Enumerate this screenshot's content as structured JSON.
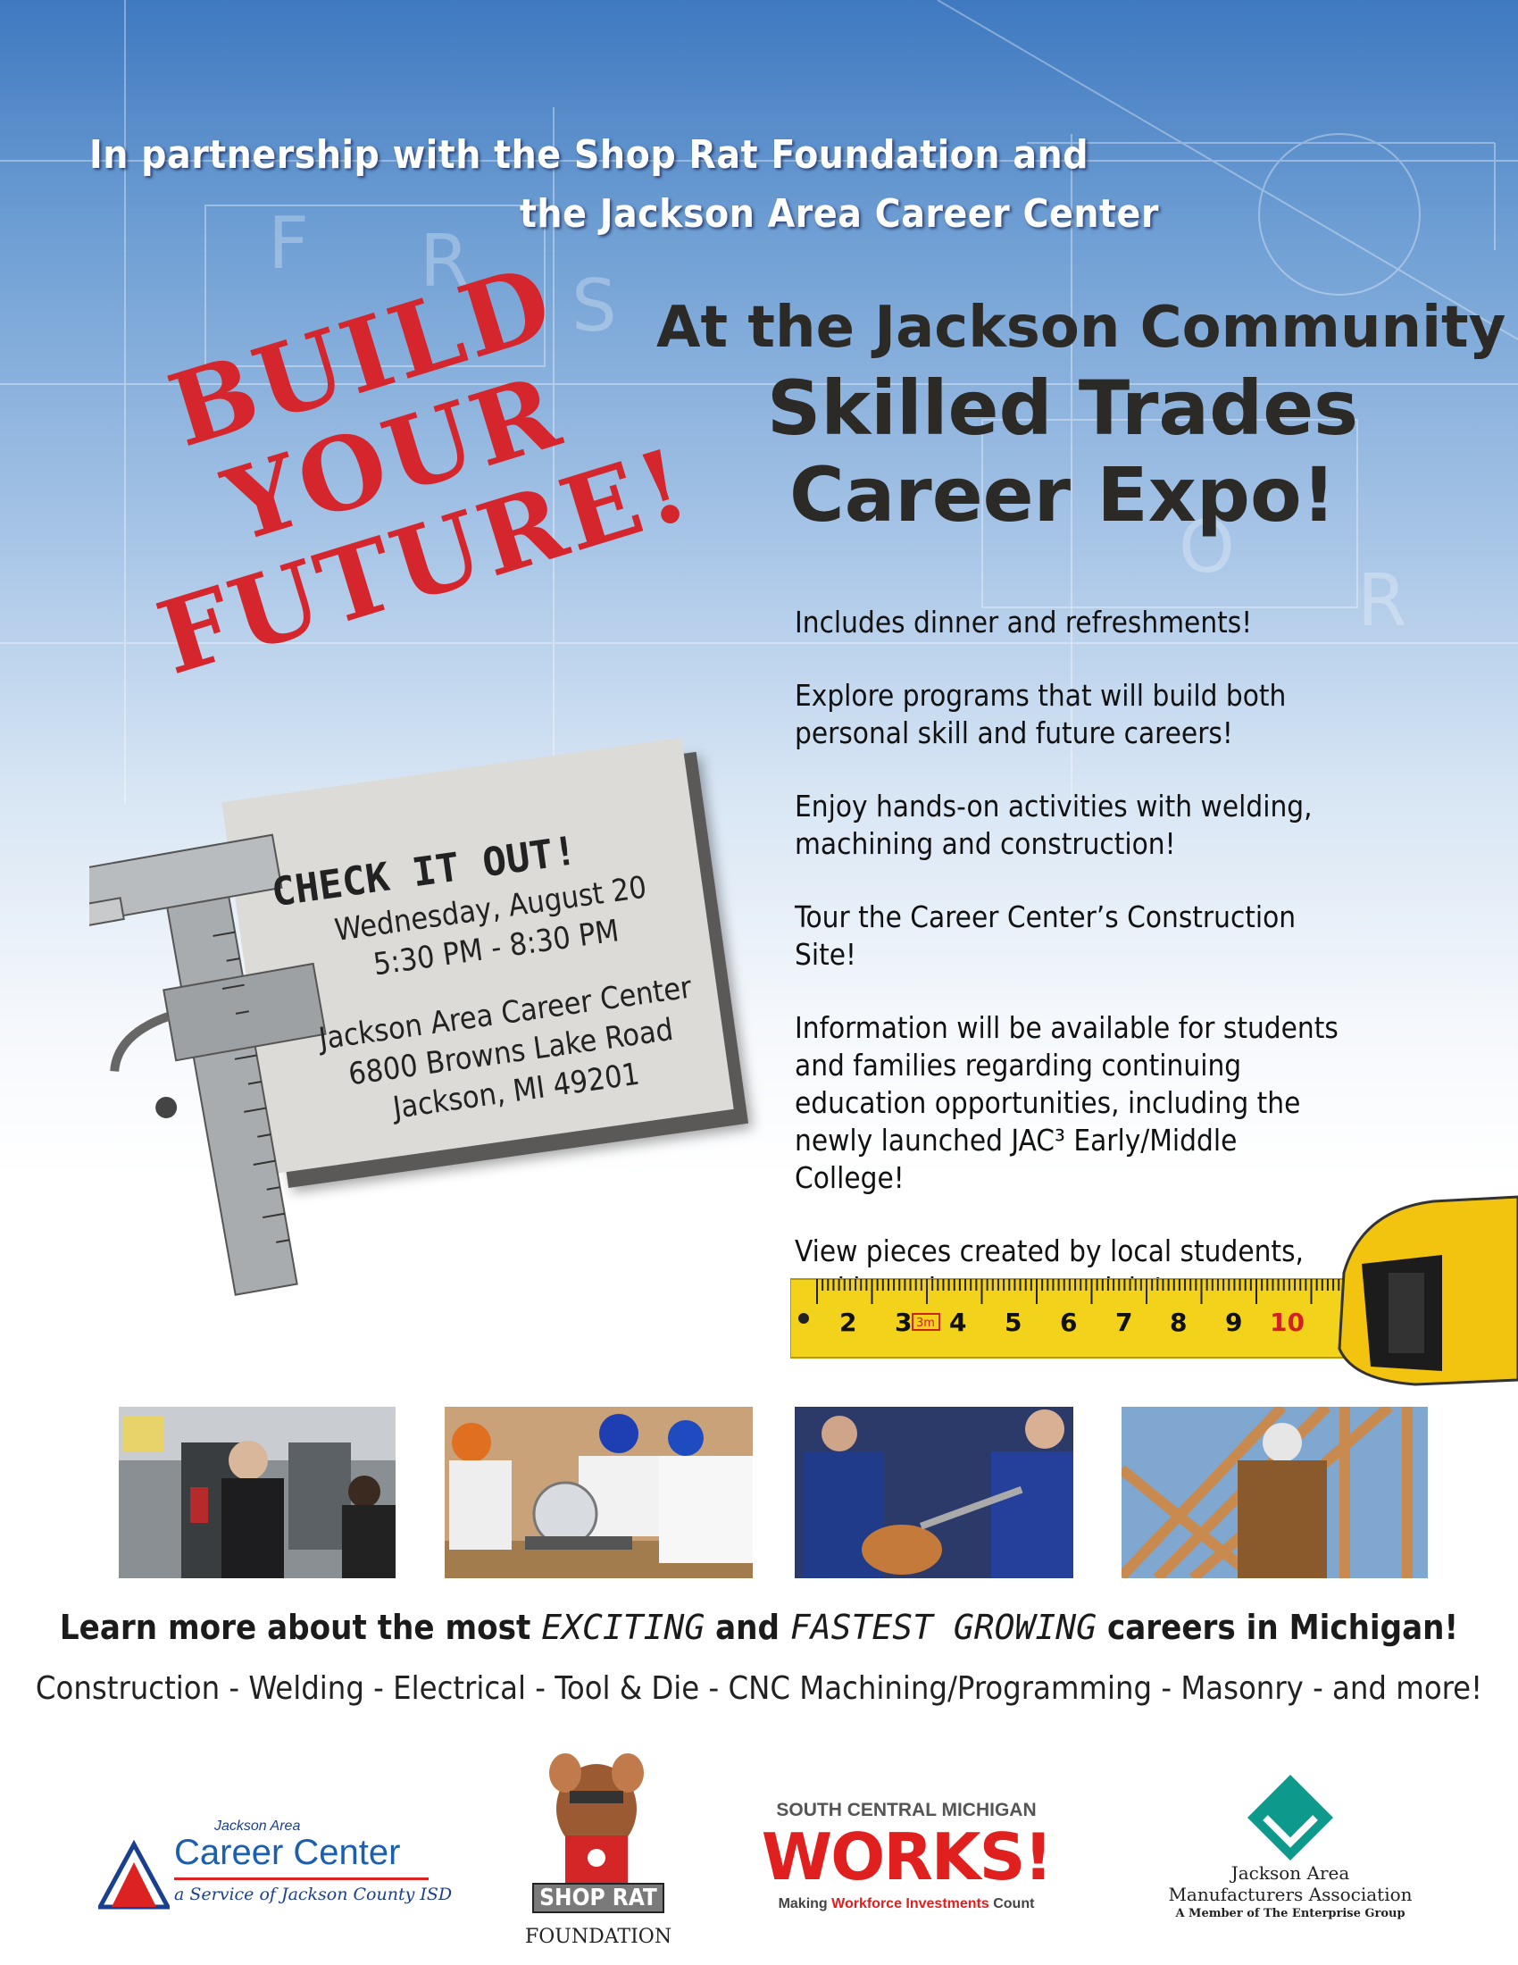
{
  "partnership": {
    "line1": "In partnership with the Shop Rat Foundation and",
    "line2": "the Jackson Area Career Center"
  },
  "headline": {
    "line1": "BUILD",
    "line2": "YOUR",
    "line3": "FUTURE!"
  },
  "expo": {
    "line1": "At the Jackson Community",
    "line2": "Skilled Trades",
    "line3": "Career Expo!"
  },
  "event": {
    "check_it_out": "CHECK IT OUT!",
    "date": "Wednesday, August 20",
    "time": "5:30 PM - 8:30 PM",
    "venue": "Jackson Area Career Center",
    "street": "6800 Browns Lake Road",
    "city": "Jackson, MI 49201"
  },
  "bullets": [
    "Includes dinner and refreshments!",
    "Explore programs that will build both personal skill and future careers!",
    "Enjoy hands-on activities with welding, machining and construction!",
    "Tour the Career Center’s Construction Site!",
    "Information will be available for students and families regarding continuing education opportunities, including the newly launched JAC³ Early/Middle College!",
    "View pieces created by local students, and learn how you can join!"
  ],
  "tape_measure": {
    "numbers": [
      "2",
      "3",
      "4",
      "5",
      "6",
      "7",
      "8",
      "9",
      "10"
    ],
    "marker": "3m"
  },
  "learn": {
    "part1": "Learn more about the most ",
    "exciting": "EXCITING",
    "and": " and ",
    "fastest": "FASTEST GROWING",
    "part2": " careers in Michigan!"
  },
  "trades_list": "Construction  - Welding  - Electrical - Tool & Die - CNC  Machining/Programming -  Masonry - and more!",
  "logos": {
    "career_center": {
      "small": "Jackson Area",
      "main": "Career Center",
      "tagline": "a Service of Jackson County ISD"
    },
    "shop_rat": {
      "badge": "SHOP RAT",
      "sub": "FOUNDATION"
    },
    "works": {
      "top": "SOUTH CENTRAL MICHIGAN",
      "main": "WORKS!",
      "tag_start": "Making ",
      "tag_mid": "Workforce Investments",
      "tag_end": " Count"
    },
    "jama": {
      "line1": "Jackson Area",
      "line2": "Manufacturers Association",
      "line3": "A Member of The Enterprise Group"
    }
  },
  "colors": {
    "headline_red": "#d4262c",
    "blueprint_blue": "#3f79c0",
    "tape_yellow": "#f2d21a",
    "jama_teal": "#0d9a8c"
  }
}
